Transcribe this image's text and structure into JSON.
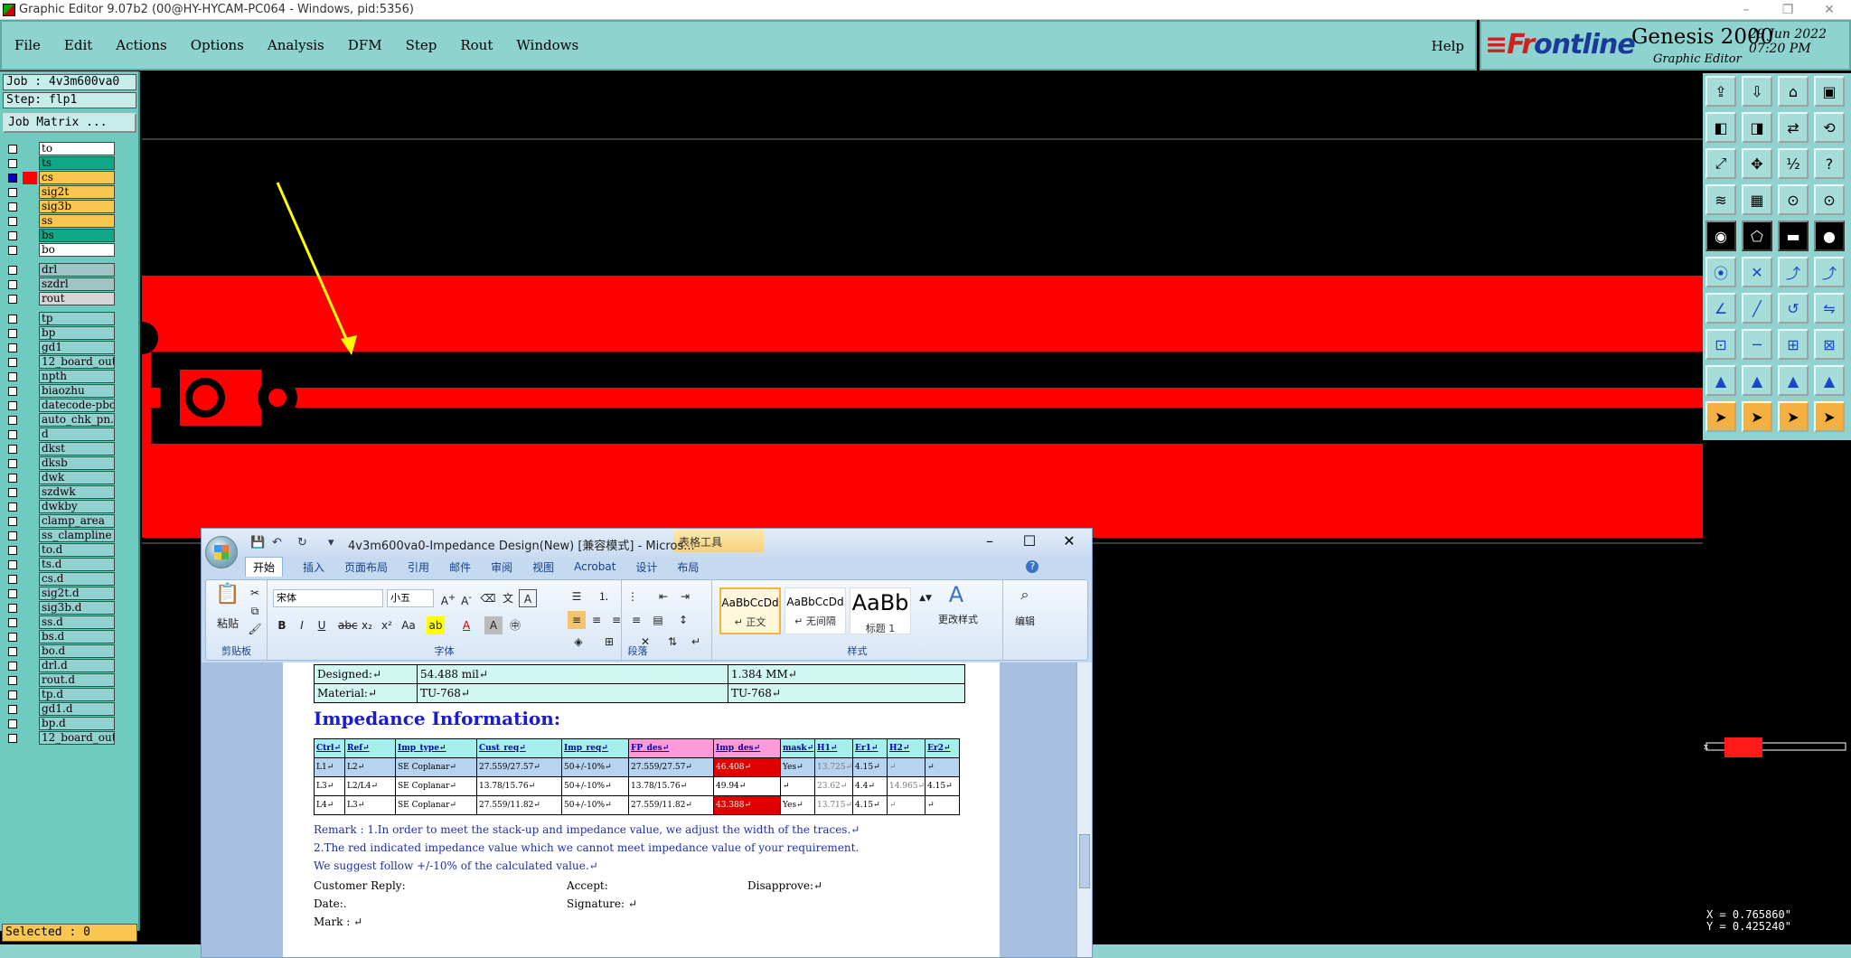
{
  "window": {
    "title": "Graphic Editor 9.07b2 (00@HY-HYCAM-PC064 - Windows, pid:5356)",
    "controls": [
      "–",
      "❐",
      "✕"
    ]
  },
  "menu": {
    "items": [
      "File",
      "Edit",
      "Actions",
      "Options",
      "Analysis",
      "DFM",
      "Step",
      "Rout",
      "Windows"
    ],
    "help": "Help"
  },
  "brand": {
    "logo_left": "≡Fr",
    "logo_right": "ontline",
    "product": "Genesis 2000",
    "subtitle": "Graphic Editor",
    "date": "29 Jun 2022",
    "time": "07:20 PM"
  },
  "left": {
    "job": "Job : 4v3m600va0",
    "step": "Step: flp1",
    "job_matrix": "Job Matrix ...",
    "selected": "Selected : 0",
    "layers": [
      {
        "name": "to",
        "color": "#ffffff",
        "checked": false
      },
      {
        "name": "ts",
        "color": "#11a887",
        "checked": false
      },
      {
        "name": "cs",
        "color": "#f9c74f",
        "checked": true,
        "active": true
      },
      {
        "name": "sig2t",
        "color": "#f9c74f",
        "checked": false
      },
      {
        "name": "sig3b",
        "color": "#f9c74f",
        "checked": false
      },
      {
        "name": "ss",
        "color": "#f9c74f",
        "checked": false
      },
      {
        "name": "bs",
        "color": "#11a887",
        "checked": false
      },
      {
        "name": "bo",
        "color": "#ffffff",
        "checked": false
      },
      {
        "name": "drl",
        "color": "#9fc4c3",
        "checked": false
      },
      {
        "name": "szdrl",
        "color": "#9fc4c3",
        "checked": false
      },
      {
        "name": "rout",
        "color": "#d6d6d6",
        "checked": false
      },
      {
        "name": "tp",
        "color": "#8fd3d0",
        "checked": false
      },
      {
        "name": "bp",
        "color": "#8fd3d0",
        "checked": false
      },
      {
        "name": "gd1",
        "color": "#8fd3d0",
        "checked": false
      },
      {
        "name": "12_board_out",
        "color": "#8fd3d0",
        "checked": false
      },
      {
        "name": "npth",
        "color": "#8fd3d0",
        "checked": false
      },
      {
        "name": "biaozhu",
        "color": "#8fd3d0",
        "checked": false
      },
      {
        "name": "datecode-pbc",
        "color": "#8fd3d0",
        "checked": false
      },
      {
        "name": "auto_chk_pn.",
        "color": "#8fd3d0",
        "checked": false
      },
      {
        "name": "d",
        "color": "#8fd3d0",
        "checked": false
      },
      {
        "name": "dkst",
        "color": "#8fd3d0",
        "checked": false
      },
      {
        "name": "dksb",
        "color": "#8fd3d0",
        "checked": false
      },
      {
        "name": "dwk",
        "color": "#8fd3d0",
        "checked": false
      },
      {
        "name": "szdwk",
        "color": "#8fd3d0",
        "checked": false
      },
      {
        "name": "dwkby",
        "color": "#8fd3d0",
        "checked": false
      },
      {
        "name": "clamp_area",
        "color": "#8fd3d0",
        "checked": false
      },
      {
        "name": "ss_clampline",
        "color": "#8fd3d0",
        "checked": false
      },
      {
        "name": "to.d",
        "color": "#8fd3d0",
        "checked": false
      },
      {
        "name": "ts.d",
        "color": "#8fd3d0",
        "checked": false
      },
      {
        "name": "cs.d",
        "color": "#8fd3d0",
        "checked": false
      },
      {
        "name": "sig2t.d",
        "color": "#8fd3d0",
        "checked": false
      },
      {
        "name": "sig3b.d",
        "color": "#8fd3d0",
        "checked": false
      },
      {
        "name": "ss.d",
        "color": "#8fd3d0",
        "checked": false
      },
      {
        "name": "bs.d",
        "color": "#8fd3d0",
        "checked": false
      },
      {
        "name": "bo.d",
        "color": "#8fd3d0",
        "checked": false
      },
      {
        "name": "drl.d",
        "color": "#8fd3d0",
        "checked": false
      },
      {
        "name": "rout.d",
        "color": "#8fd3d0",
        "checked": false
      },
      {
        "name": "tp.d",
        "color": "#8fd3d0",
        "checked": false
      },
      {
        "name": "gd1.d",
        "color": "#8fd3d0",
        "checked": false
      },
      {
        "name": "bp.d",
        "color": "#8fd3d0",
        "checked": false
      },
      {
        "name": "12_board_out",
        "color": "#8fd3d0",
        "checked": false
      }
    ]
  },
  "coords": {
    "x": "X = 0.765860\"",
    "y": "Y = 0.425240\""
  },
  "word": {
    "title": "4v3m600va0-Impedance Design(New) [兼容模式] - Micros...",
    "table_tools": "表格工具",
    "tabs": [
      "开始",
      "插入",
      "页面布局",
      "引用",
      "邮件",
      "审阅",
      "视图",
      "Acrobat",
      "设计",
      "布局"
    ],
    "clipboard": {
      "paste": "粘贴",
      "label": "剪贴板"
    },
    "font": {
      "name": "宋体",
      "size": "小五",
      "label": "字体"
    },
    "paragraph_label": "段落",
    "styles": {
      "items": [
        {
          "sample": "AaBbCcDd",
          "name": "↵ 正文"
        },
        {
          "sample": "AaBbCcDd",
          "name": "↵ 无间隔"
        },
        {
          "sample": "AaBb",
          "name": "标题 1"
        }
      ],
      "change": "更改样式",
      "label": "样式"
    },
    "edit": "编辑",
    "doc": {
      "top_rows": [
        [
          "Designed:↵",
          "54.488 mil↵",
          "1.384 MM↵"
        ],
        [
          "Material:↵",
          "TU-768↵",
          "TU-768↵"
        ]
      ],
      "heading": "Impedance Information:",
      "headers": [
        "Ctrl↵",
        "Ref↵",
        "Imp_type↵",
        "Cust_req↵",
        "Imp_req↵",
        "FP_des↵",
        "Imp_des↵",
        "mask↵",
        "H1↵",
        "Er1↵",
        "H2↵",
        "Er2↵"
      ],
      "rows": [
        [
          "L1↵",
          "L2↵",
          "SE Coplanar↵",
          "27.559/27.57↵",
          "50+/-10%↵",
          "27.559/27.57↵",
          "46.408↵",
          "Yes↵",
          "13.725↵",
          "4.15↵",
          "↵",
          "↵"
        ],
        [
          "L3↵",
          "L2/L4↵",
          "SE Coplanar↵",
          "13.78/15.76↵",
          "50+/-10%↵",
          "13.78/15.76↵",
          "49.94↵",
          "↵",
          "23.62↵",
          "4.4↵",
          "14.965↵",
          "4.15↵"
        ],
        [
          "L4↵",
          "L3↵",
          "SE Coplanar↵",
          "27.559/11.82↵",
          "50+/-10%↵",
          "27.559/11.82↵",
          "43.388↵",
          "Yes↵",
          "13.715↵",
          "4.15↵",
          "↵",
          "↵"
        ]
      ],
      "remark1": "Remark : 1.In order to meet the stack-up and impedance value, we adjust the width of the traces.↵",
      "remark2": "2.The red indicated impedance value which we cannot meet impedance value of your requirement.",
      "remark3": "We suggest follow +/-10% of the calculated value.↵",
      "customer_reply": "Customer Reply:",
      "accept": "Accept:",
      "disapprove": "Disapprove:↵",
      "date": "Date:.",
      "signature": "Signature: ↵",
      "mark": "Mark : ↵"
    }
  },
  "toolbar_icons": [
    "open-step-icon",
    "save-icon",
    "home-icon",
    "window-icon",
    "zoom-left-icon",
    "zoom-right-icon",
    "pan-icon",
    "redraw-icon",
    "fit-icon",
    "center-icon",
    "scale-icon",
    "help-icon",
    "measure-icon",
    "grid-icon",
    "snap-icon",
    "snap2-icon",
    "camera-icon",
    "shape-icon",
    "line-icon",
    "pad-icon",
    "connect-icon",
    "cross-icon",
    "route-icon",
    "route2-icon",
    "angle-icon",
    "draw-icon",
    "rotate-icon",
    "mirror-icon",
    "ref-icon",
    "minus-icon",
    "array-icon",
    "transform-icon",
    "triangle-icon",
    "triangle2-icon",
    "triangle3-icon",
    "triangle4-icon",
    "select-icon",
    "select2-icon",
    "select3-icon",
    "select4-icon"
  ],
  "colors": {
    "panel": "#8fd3d0",
    "copper": "#ff0000",
    "highlight": "#ffff00",
    "layer_active": "#f9c74f",
    "impedance_fail": "#e00000"
  }
}
